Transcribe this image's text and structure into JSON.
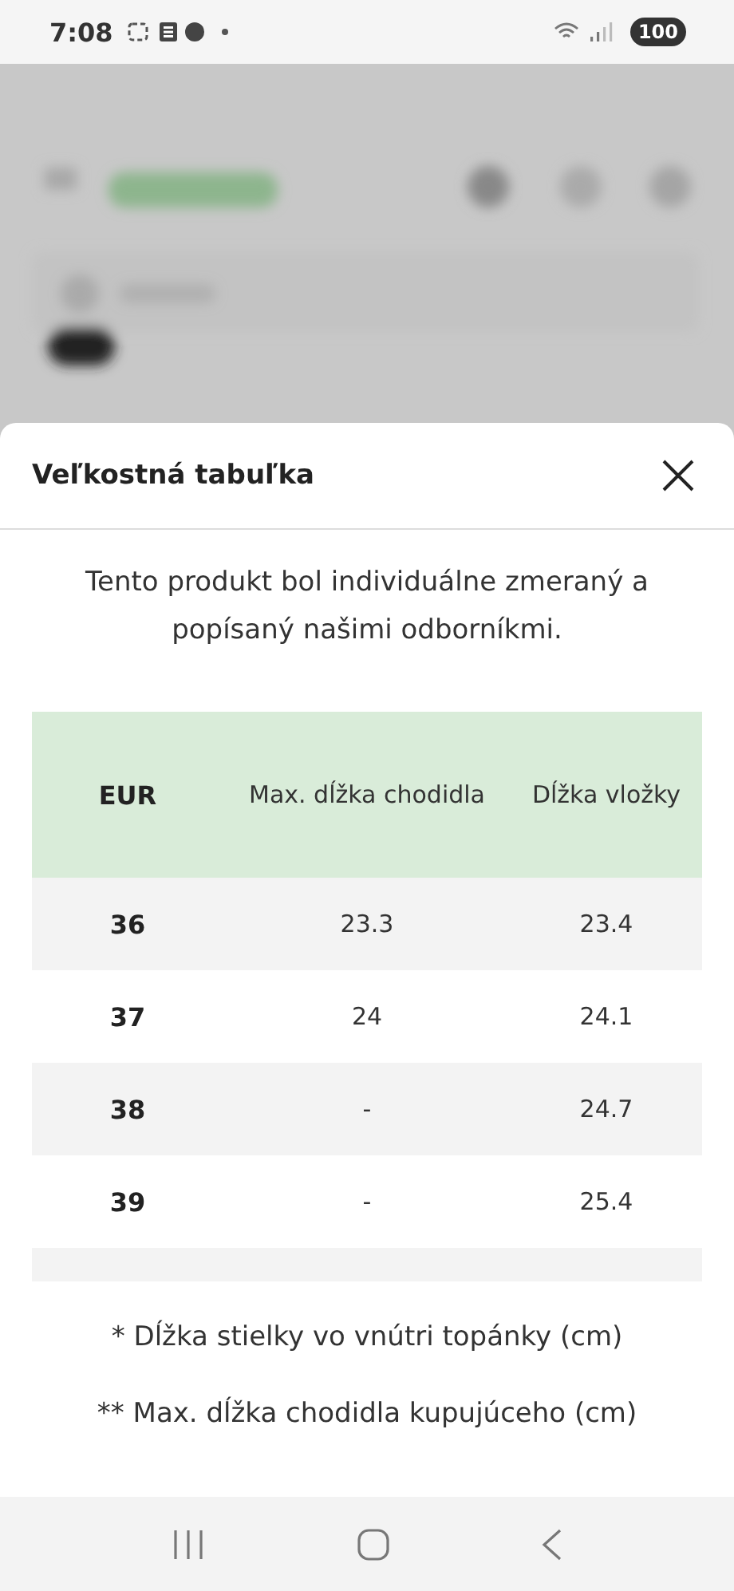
{
  "status_bar": {
    "time": "7:08",
    "battery": "100"
  },
  "sheet": {
    "title": "Veľkostná tabuľka",
    "intro": "Tento produkt bol individuálne zmeraný a popísaný našimi odborníkmi."
  },
  "table": {
    "columns": [
      "EUR",
      "Max. dĺžka chodidla",
      "Dĺžka vložky"
    ],
    "rows": [
      [
        "36",
        "23.3",
        "23.4"
      ],
      [
        "37",
        "24",
        "24.1"
      ],
      [
        "38",
        "-",
        "24.7"
      ],
      [
        "39",
        "-",
        "25.4"
      ]
    ]
  },
  "footnotes": [
    "* Dĺžka stielky vo vnútri topánky (cm)",
    "** Max. dĺžka chodidla kupujúceho (cm)"
  ]
}
